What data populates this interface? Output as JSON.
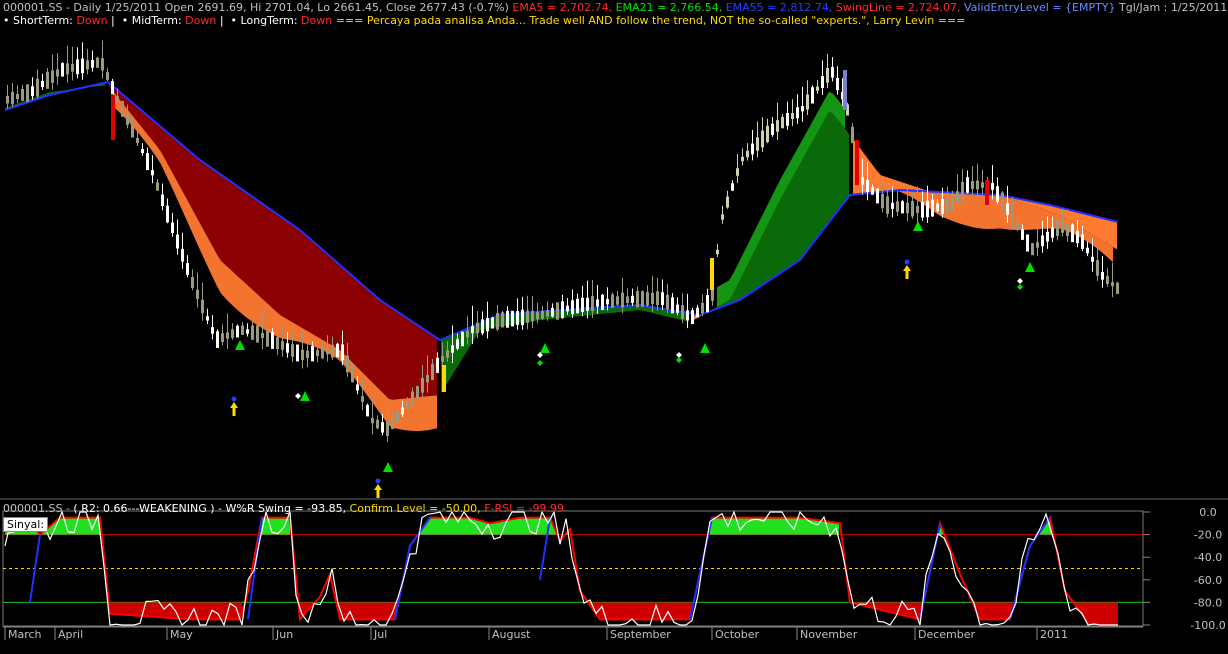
{
  "colors": {
    "background": "#000000",
    "ema_fill_down": "#8b0000",
    "ema_fill_up": "#0a6a0a",
    "ema_fill_up_light": "#18b018",
    "swing_fill_down": "#ff7a30",
    "ema55_line": "#2030ff",
    "osc_red": "#ff0000",
    "osc_blue": "#2030ff",
    "osc_white": "#ffffff",
    "osc_green_fill": "#20e020",
    "osc_red_fill": "#cc0000",
    "up_arrow": "#00e000"
  },
  "header": {
    "line1": {
      "symbol": "000001.SS - Daily 1/25/2011 Open 2691.69, Hi 2701.04, Lo 2661.45, Close 2677.43 (-0.7%)",
      "ema5": "EMA5 = 2,702.74,",
      "ema21": "EMA21 = 2,766.54,",
      "ema55": "EMA55 = 2,812.74,",
      "swing": "SwingLine = 2,724.07,",
      "valid": "ValidEntryLevel = {EMPTY}",
      "tgl": "Tgl/Jam : 1/25/2011 00:00:00"
    },
    "line2": {
      "short_label": "• ShortTerm:",
      "short_val": "Down",
      "sep1": "|",
      "mid_label": "• MidTerm:",
      "mid_val": "Down",
      "sep2": "|",
      "long_label": "• LongTerm:",
      "long_val": "Down",
      "quote": "=== Percaya pada analisa Anda... Trade well AND follow the trend, NOT the so-called \"experts.\", Larry Levin ==="
    }
  },
  "indicator": {
    "header": {
      "prefix": "000001.SS - ",
      "r2": "( R2: 0.66---WEAKENING ) - W%R Swing = -93.85,",
      "confirm": "Confirm Level = -50.00,",
      "frsi": "F-RSI = -99.99"
    },
    "sinyal_label": "Sinyal:"
  },
  "chart_data": [
    {
      "type": "candlestick",
      "title": "000001.SS - Daily",
      "x_labels": [
        "March",
        "April",
        "May",
        "Jun",
        "Jul",
        "August",
        "September",
        "October",
        "November",
        "December",
        "2011"
      ],
      "approx_close_trend": [
        {
          "month": "April",
          "value": 3150
        },
        {
          "month": "May",
          "value": 2850
        },
        {
          "month": "Jun",
          "value": 2550
        },
        {
          "month": "Jul",
          "value": 2400
        },
        {
          "month": "August",
          "value": 2650
        },
        {
          "month": "September",
          "value": 2600
        },
        {
          "month": "October",
          "value": 2900
        },
        {
          "month": "November",
          "value": 3100
        },
        {
          "month": "December",
          "value": 2850
        },
        {
          "month": "2011",
          "value": 2677
        }
      ],
      "last": {
        "open": 2691.69,
        "high": 2701.04,
        "low": 2661.45,
        "close": 2677.43,
        "change_pct": -0.7
      },
      "indicators": {
        "EMA5": 2702.74,
        "EMA21": 2766.54,
        "EMA55": 2812.74,
        "SwingLine": 2724.07,
        "ValidEntryLevel": "{EMPTY}"
      }
    },
    {
      "type": "line",
      "title": "W%R Swing",
      "y_ticks": [
        "0.0",
        "-20.0",
        "-40.0",
        "-60.0",
        "-80.0",
        "-100.0"
      ],
      "ylim": [
        -100,
        0
      ],
      "levels": {
        "upper": -20,
        "confirm": -50,
        "lower": -80
      },
      "values": {
        "W%R Swing": -93.85,
        "Confirm Level": -50.0,
        "F-RSI": -99.99
      }
    }
  ]
}
